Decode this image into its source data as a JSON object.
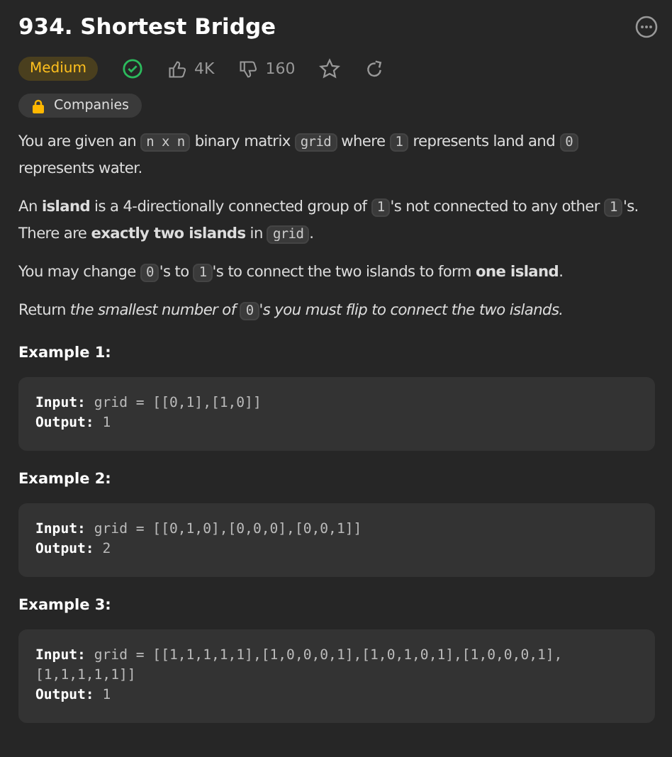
{
  "title": "934. Shortest Bridge",
  "difficulty": "Medium",
  "solved": true,
  "likes": "4K",
  "dislikes": "160",
  "companies": "Companies",
  "paragraphs": [
    [
      {
        "kind": "text",
        "text": "You are given an "
      },
      {
        "kind": "code",
        "text": "n x n"
      },
      {
        "kind": "text",
        "text": " binary matrix "
      },
      {
        "kind": "code",
        "text": "grid"
      },
      {
        "kind": "text",
        "text": " where "
      },
      {
        "kind": "code",
        "text": "1"
      },
      {
        "kind": "text",
        "text": " represents land and "
      },
      {
        "kind": "code",
        "text": "0"
      },
      {
        "kind": "text",
        "text": " represents water."
      }
    ],
    [
      {
        "kind": "text",
        "text": "An **island** is a 4-directionally connected group of "
      },
      {
        "kind": "code",
        "text": "1"
      },
      {
        "kind": "text",
        "text": "'s not connected to any other "
      },
      {
        "kind": "code",
        "text": "1"
      },
      {
        "kind": "text",
        "text": "'s. There are **exactly two islands** in "
      },
      {
        "kind": "code",
        "text": "grid"
      },
      {
        "kind": "text",
        "text": "."
      }
    ],
    [
      {
        "kind": "text",
        "text": "You may change "
      },
      {
        "kind": "code",
        "text": "0"
      },
      {
        "kind": "text",
        "text": "'s to "
      },
      {
        "kind": "code",
        "text": "1"
      },
      {
        "kind": "text",
        "text": "'s to connect the two islands to form **one island**."
      }
    ],
    [
      {
        "kind": "text",
        "text": "Return *the smallest number of* "
      },
      {
        "kind": "code",
        "text": "0"
      },
      {
        "kind": "text",
        "text": "*'s you must flip to connect the two islands.*"
      }
    ]
  ],
  "examples": [
    {
      "heading": "Example 1:",
      "lines": [
        {
          "label": "Input:",
          "value": "grid = [[0,1],[1,0]]"
        },
        {
          "label": "Output:",
          "value": "1"
        }
      ]
    },
    {
      "heading": "Example 2:",
      "lines": [
        {
          "label": "Input:",
          "value": "grid = [[0,1,0],[0,0,0],[0,0,1]]"
        },
        {
          "label": "Output:",
          "value": "2"
        }
      ]
    },
    {
      "heading": "Example 3:",
      "lines": [
        {
          "label": "Input:",
          "value": "grid = [[1,1,1,1,1],[1,0,0,0,1],[1,0,1,0,1],[1,0,0,0,1],"
        },
        {
          "value": "[1,1,1,1,1]]"
        },
        {
          "label": "Output:",
          "value": "1"
        }
      ]
    }
  ]
}
